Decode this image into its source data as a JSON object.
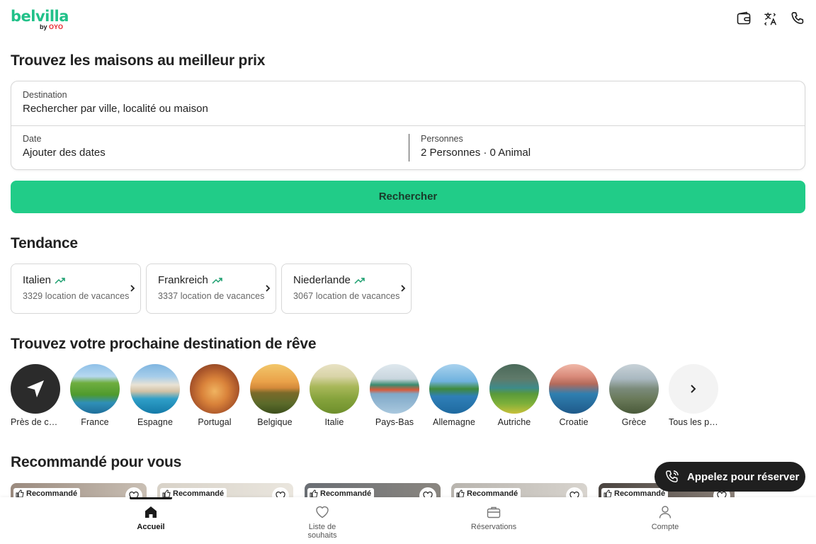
{
  "header": {
    "logo_main": "belvilla",
    "logo_by": "by ",
    "logo_oyo": "OYO",
    "icons": [
      "wallet-icon",
      "translate-icon",
      "phone-icon"
    ]
  },
  "hero": {
    "title": "Trouvez les maisons au meilleur prix"
  },
  "search": {
    "destination_label": "Destination",
    "destination_placeholder": "Rechercher par ville, localité ou maison",
    "date_label": "Date",
    "date_placeholder": "Ajouter des dates",
    "persons_label": "Personnes",
    "persons_value": "2 Personnes · 0 Animal",
    "button_label": "Rechercher"
  },
  "trending": {
    "title": "Tendance",
    "items": [
      {
        "name": "Italien",
        "count": "3329 location de vacances"
      },
      {
        "name": "Frankreich",
        "count": "3337 location de vacances"
      },
      {
        "name": "Niederlande",
        "count": "3067 location de vacances"
      }
    ]
  },
  "destinations": {
    "title": "Trouvez votre prochaine destination de rêve",
    "items": [
      {
        "label": "Près de chez vous"
      },
      {
        "label": "France"
      },
      {
        "label": "Espagne"
      },
      {
        "label": "Portugal"
      },
      {
        "label": "Belgique"
      },
      {
        "label": "Italie"
      },
      {
        "label": "Pays-Bas"
      },
      {
        "label": "Allemagne"
      },
      {
        "label": "Autriche"
      },
      {
        "label": "Croatie"
      },
      {
        "label": "Grèce"
      },
      {
        "label": "Tous les pays"
      }
    ]
  },
  "recommended": {
    "title": "Recommandé pour vous",
    "badge": "Recommandé"
  },
  "call": {
    "label": "Appelez pour réserver"
  },
  "nav": {
    "items": [
      {
        "label": "Accueil",
        "icon": "home-icon"
      },
      {
        "label": "Liste de souhaits",
        "icon": "heart-icon"
      },
      {
        "label": "Réservations",
        "icon": "briefcase-icon"
      },
      {
        "label": "Compte",
        "icon": "user-icon"
      }
    ]
  },
  "colors": {
    "brand_green": "#21c189",
    "button_green": "#21cc88",
    "oyo_red": "#e8232b",
    "dark": "#1f1f1f"
  }
}
